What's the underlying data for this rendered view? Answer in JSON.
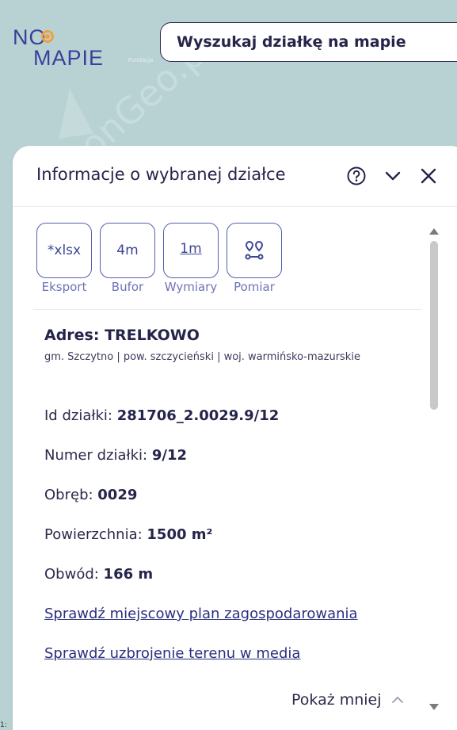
{
  "logo": {
    "line1": "NO",
    "line2": "MAPIE",
    "tag": "Fundacja"
  },
  "watermark": "onGeo.pl",
  "search": {
    "placeholder": "Wyszukaj działkę na mapie"
  },
  "panel": {
    "title": "Informacje o wybranej działce",
    "tools": [
      {
        "icon_text": "*xlsx",
        "label": "Eksport"
      },
      {
        "icon_text": "4m",
        "label": "Bufor"
      },
      {
        "icon_text": "1m",
        "label": "Wymiary"
      },
      {
        "icon_text": "",
        "label": "Pomiar"
      }
    ],
    "address": {
      "label": "Adres: TRELKOWO",
      "sub": "gm. Szczytno | pow. szczycieński | woj. warmińsko-mazurskie"
    },
    "fields": [
      {
        "label": "Id działki: ",
        "value": "281706_2.0029.9/12"
      },
      {
        "label": "Numer działki: ",
        "value": "9/12"
      },
      {
        "label": "Obręb: ",
        "value": "0029"
      },
      {
        "label": "Powierzchnia: ",
        "value": "1500 m²"
      },
      {
        "label": "Obwód: ",
        "value": "166 m"
      }
    ],
    "links": [
      "Sprawdź miejscowy plan zagospodarowania",
      "Sprawdź uzbrojenie terenu w media"
    ],
    "toggle_label": "Pokaż mniej"
  },
  "corner_text": "1:"
}
